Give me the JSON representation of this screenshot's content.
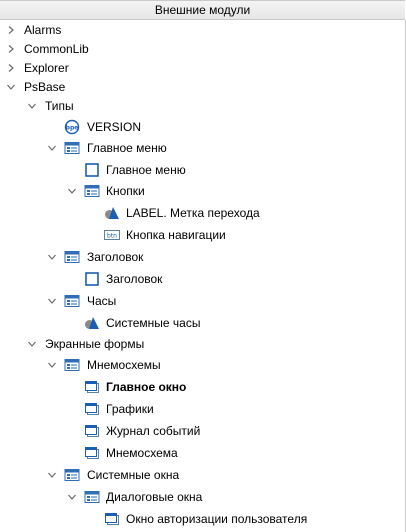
{
  "panel": {
    "title": "Внешние модули"
  },
  "tree": {
    "alarms": "Alarms",
    "commonlib": "CommonLib",
    "explorer": "Explorer",
    "psbase": "PsBase",
    "types": "Типы",
    "version": "VERSION",
    "main_menu_group": "Главное меню",
    "main_menu_item": "Главное меню",
    "buttons": "Кнопки",
    "label_mark": "LABEL. Метка перехода",
    "nav_button": "Кнопка навигации",
    "header_group": "Заголовок",
    "header_item": "Заголовок",
    "clock_group": "Часы",
    "system_clock": "Системные часы",
    "screen_forms": "Экранные формы",
    "mnemo_group": "Мнемосхемы",
    "main_window": "Главное окно",
    "charts": "Графики",
    "event_log": "Журнал событий",
    "mnemo_item": "Мнемосхема",
    "system_windows": "Системные окна",
    "dialog_windows": "Диалоговые окна",
    "auth_window": "Окно авторизации пользователя"
  },
  "icons": {
    "folder": "group-folder-icon",
    "form": "form-icon",
    "square": "object-icon",
    "shapes": "shapes-icon",
    "btn": "button-icon",
    "bool": "bool-type-icon"
  },
  "colors": {
    "accent": "#1a5fb4"
  }
}
